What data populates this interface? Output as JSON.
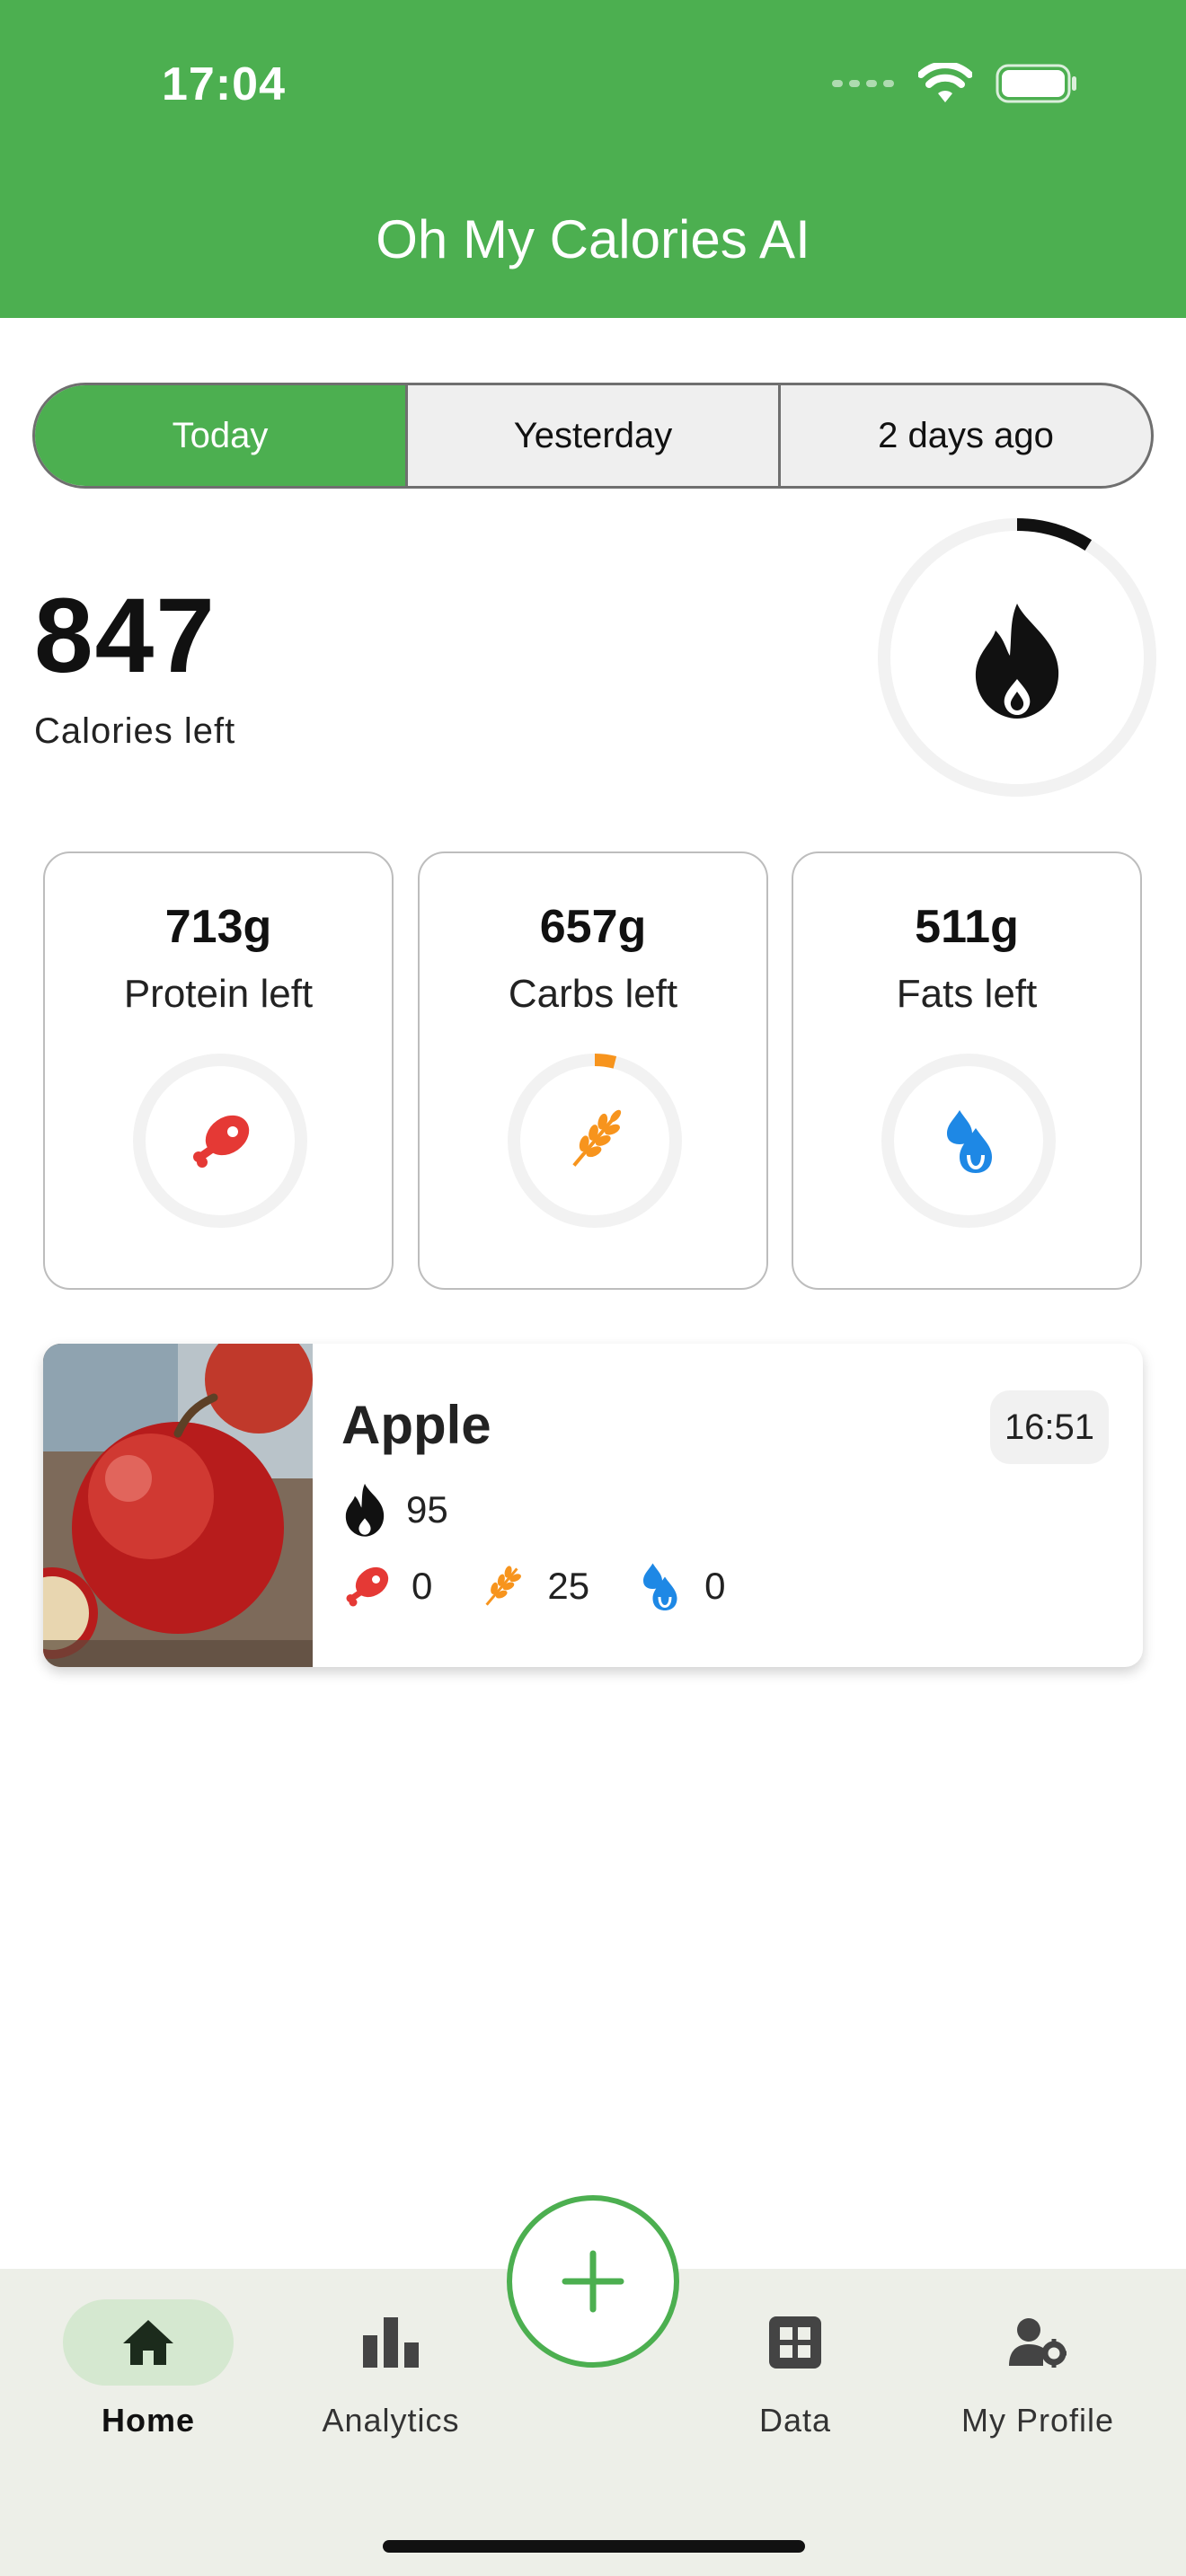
{
  "status_bar": {
    "time": "17:04"
  },
  "app": {
    "title": "Oh My Calories AI"
  },
  "day_tabs": [
    {
      "label": "Today",
      "active": true
    },
    {
      "label": "Yesterday",
      "active": false
    },
    {
      "label": "2 days ago",
      "active": false
    }
  ],
  "calories": {
    "value": "847",
    "label": "Calories left",
    "consumed_fraction": 0.09,
    "icon": "flame-icon"
  },
  "macros": [
    {
      "value": "713g",
      "label": "Protein left",
      "icon": "meat-icon",
      "color": "#e53935",
      "fraction": 0.0
    },
    {
      "value": "657g",
      "label": "Carbs left",
      "icon": "wheat-icon",
      "color": "#f7941d",
      "fraction": 0.04
    },
    {
      "value": "511g",
      "label": "Fats left",
      "icon": "drops-icon",
      "color": "#1e88e5",
      "fraction": 0.0
    }
  ],
  "food_entries": [
    {
      "name": "Apple",
      "time": "16:51",
      "calories": "95",
      "protein": "0",
      "carbs": "25",
      "fats": "0"
    }
  ],
  "nav": {
    "items": [
      {
        "label": "Home",
        "icon": "home-icon",
        "active": true
      },
      {
        "label": "Analytics",
        "icon": "bar-chart-icon",
        "active": false
      },
      {
        "label": "Data",
        "icon": "grid-icon",
        "active": false
      },
      {
        "label": "My Profile",
        "icon": "profile-settings-icon",
        "active": false
      }
    ],
    "add_icon": "plus-icon"
  },
  "colors": {
    "primary": "#4caf50",
    "protein": "#e53935",
    "carbs": "#f7941d",
    "fats": "#1e88e5",
    "track": "#f2f2f2"
  }
}
